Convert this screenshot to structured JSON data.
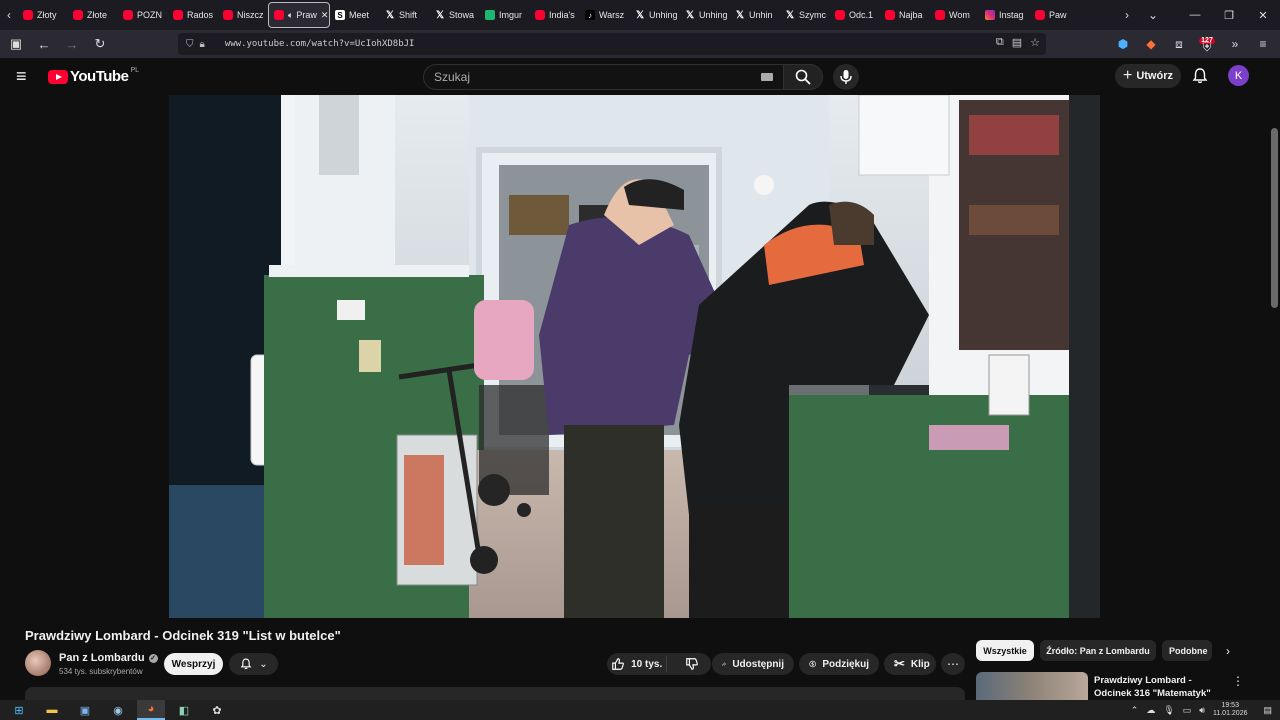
{
  "browser": {
    "tabs": [
      {
        "label": "Złoty",
        "icon": "yt"
      },
      {
        "label": "Złote",
        "icon": "yt"
      },
      {
        "label": "POZN",
        "icon": "yt"
      },
      {
        "label": "Rados",
        "icon": "yt"
      },
      {
        "label": "Niszcz",
        "icon": "yt"
      },
      {
        "label": "Praw",
        "icon": "yt",
        "active": true
      },
      {
        "label": "Meet",
        "icon": "s"
      },
      {
        "label": "Shift",
        "icon": "x"
      },
      {
        "label": "Stowa",
        "icon": "x"
      },
      {
        "label": "Imgur",
        "icon": "img"
      },
      {
        "label": "India's",
        "icon": "yt"
      },
      {
        "label": "Warsz",
        "icon": "tt"
      },
      {
        "label": "Unhing",
        "icon": "x"
      },
      {
        "label": "Unhing",
        "icon": "x"
      },
      {
        "label": "Unhin",
        "icon": "x"
      },
      {
        "label": "Szymc",
        "icon": "x"
      },
      {
        "label": "Odc.1",
        "icon": "yt"
      },
      {
        "label": "Najba",
        "icon": "yt"
      },
      {
        "label": "Wom",
        "icon": "yt"
      },
      {
        "label": "Instag",
        "icon": "ig"
      },
      {
        "label": "Paw",
        "icon": "yt"
      }
    ],
    "url": "www.youtube.com/watch?v=UcIohXD8bJI",
    "tab_badge": "127"
  },
  "youtube": {
    "logo_text": "YouTube",
    "country": "PL",
    "search_placeholder": "Szukaj",
    "create_label": "Utwórz",
    "avatar_letter": "K"
  },
  "video": {
    "title": "Prawdziwy Lombard - Odcinek 319 \"List w butelce\"",
    "channel": "Pan z Lombardu",
    "subscribers": "534 tys. subskrybentów",
    "support_label": "Wesprzyj",
    "likes": "10 tys.",
    "share_label": "Udostępnij",
    "thanks_label": "Podziękuj",
    "clip_label": "Klip"
  },
  "chips": [
    "Wszystkie",
    "Źródło: Pan z Lombardu",
    "Podobne"
  ],
  "recommended": {
    "title": "Prawdziwy Lombard - Odcinek 316 \"Matematyk\""
  },
  "taskbar": {
    "time": "19:53",
    "date": "11.01.2026"
  },
  "colors": {
    "accent_red": "#ff0033",
    "bg": "#0f0f0f",
    "avatar": "#7b3fc9"
  }
}
